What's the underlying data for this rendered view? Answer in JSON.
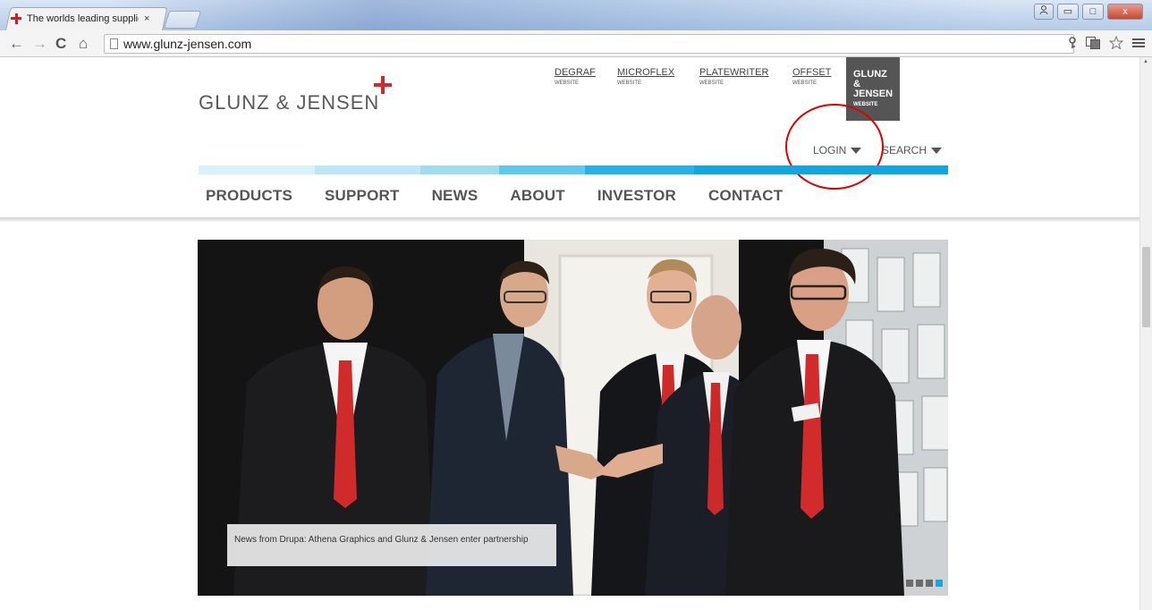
{
  "browser": {
    "tab_title": "The worlds leading supplier",
    "tab_close": "×",
    "url": "www.glunz-jensen.com",
    "window_buttons": [
      "▭",
      "□",
      "x"
    ],
    "nav": {
      "back": "←",
      "forward": "→",
      "reload": "C",
      "home": "⌂"
    },
    "toolbar_icons": [
      "key-icon",
      "translate-icon",
      "star-icon",
      "menu-icon"
    ]
  },
  "header": {
    "logo_text": "GLUNZ & JENSEN",
    "sites": [
      {
        "label": "DEGRAF",
        "sub": "WEBSITE"
      },
      {
        "label": "MICROFLEX",
        "sub": "WEBSITE"
      },
      {
        "label": "PLATEWRITER",
        "sub": "WEBSITE"
      },
      {
        "label": "OFFSET",
        "sub": "WEBSITE"
      },
      {
        "label": "GLUNZ & JENSEN",
        "sub": "WEBSITE",
        "active": true
      }
    ],
    "login_label": "LOGIN",
    "search_label": "SEARCH",
    "colorbar": [
      "#d9f1fa",
      "#bde7f6",
      "#9fdcf2",
      "#5fc8ee",
      "#26b2e8",
      "#0fa6e2"
    ]
  },
  "main_nav": {
    "items": [
      "PRODUCTS",
      "SUPPORT",
      "NEWS",
      "ABOUT",
      "INVESTOR",
      "CONTACT"
    ]
  },
  "hero": {
    "caption": "News from Drupa: Athena Graphics and Glunz & Jensen enter partnership",
    "slides": 4,
    "active_slide": 3
  },
  "colors": {
    "brand_red": "#d7262d",
    "accent_blue": "#19a6e0",
    "text_gray": "#555555",
    "annotation_red": "#e00000"
  }
}
